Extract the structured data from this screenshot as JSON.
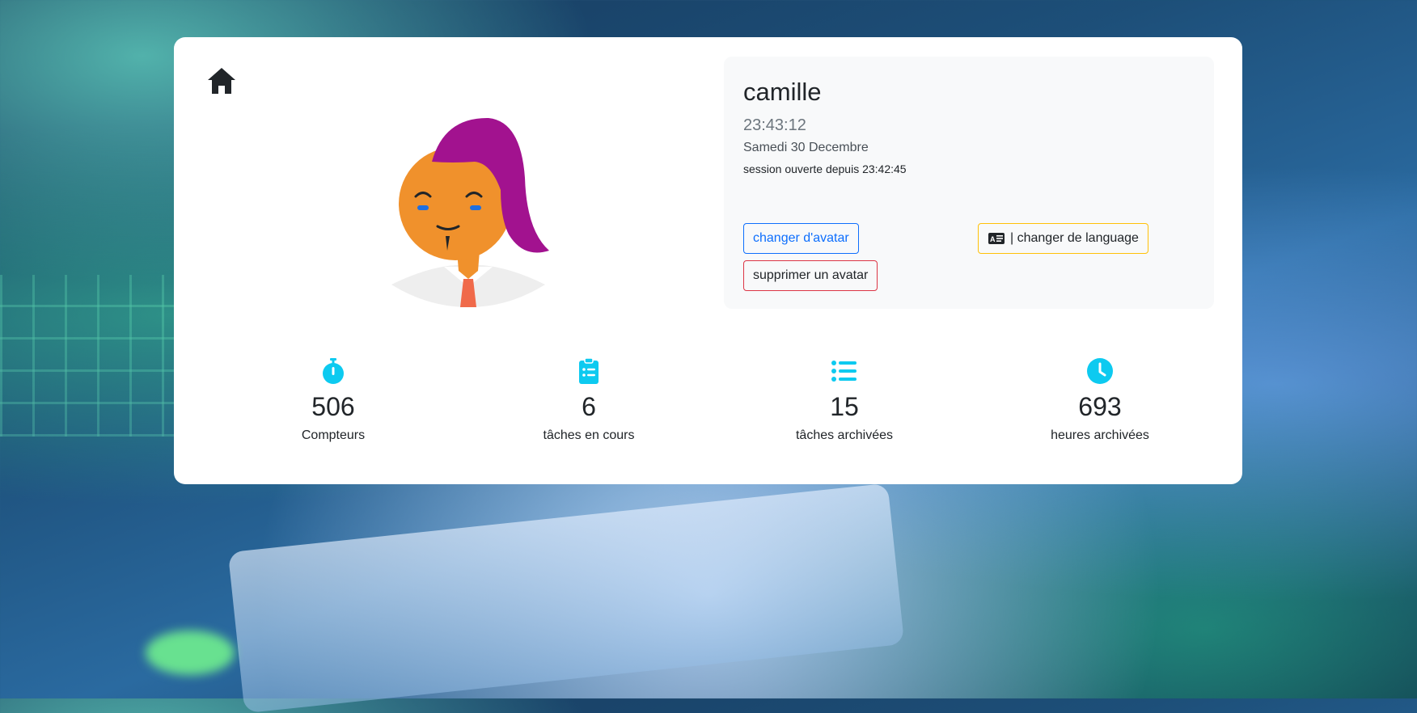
{
  "profile": {
    "name": "camille",
    "time": "23:43:12",
    "date": "Samedi 30 Decembre",
    "session": "session ouverte depuis 23:42:45"
  },
  "actions": {
    "change_avatar": "changer d'avatar",
    "change_language": "| changer de language",
    "delete_avatar": "supprimer un avatar"
  },
  "stats": [
    {
      "icon": "stopwatch-icon",
      "value": "506",
      "label": "Compteurs"
    },
    {
      "icon": "clipboard-list-icon",
      "value": "6",
      "label": "tâches en cours"
    },
    {
      "icon": "list-icon",
      "value": "15",
      "label": "tâches archivées"
    },
    {
      "icon": "clock-icon",
      "value": "693",
      "label": "heures archivées"
    }
  ],
  "colors": {
    "accent": "#0dcaf0",
    "primary": "#0d6efd",
    "warning": "#ffc107",
    "danger": "#dc3545"
  }
}
